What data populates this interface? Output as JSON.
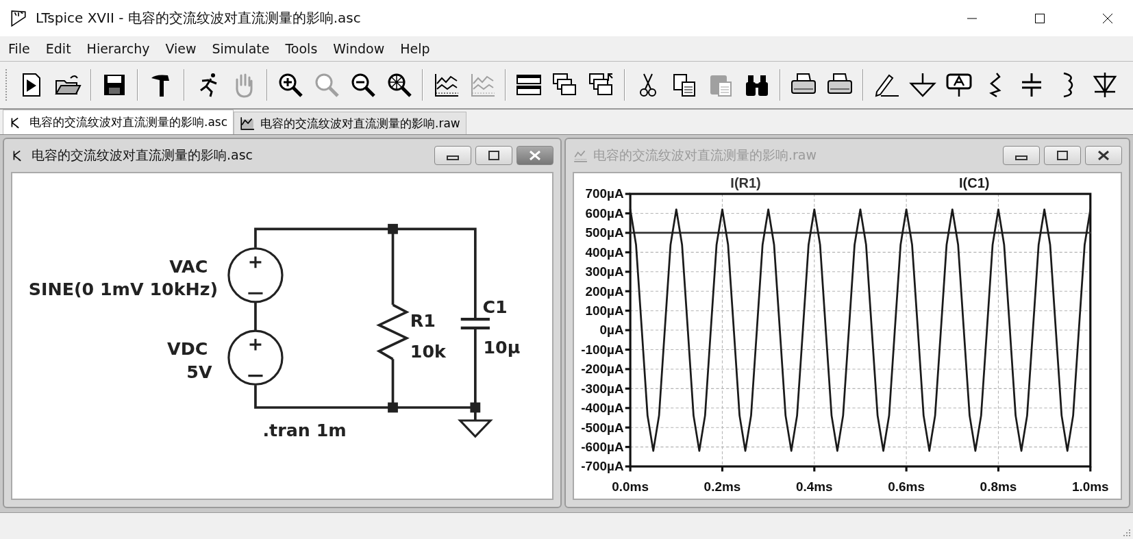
{
  "window": {
    "title": "LTspice XVII - 电容的交流纹波对直流测量的影响.asc"
  },
  "menu": [
    {
      "label": "File"
    },
    {
      "label": "Edit"
    },
    {
      "label": "Hierarchy"
    },
    {
      "label": "View"
    },
    {
      "label": "Simulate"
    },
    {
      "label": "Tools"
    },
    {
      "label": "Window"
    },
    {
      "label": "Help"
    }
  ],
  "toolbar": [
    {
      "kind": "run",
      "disabled": false
    },
    {
      "kind": "open",
      "disabled": false
    },
    {
      "kind": "separator"
    },
    {
      "kind": "save",
      "disabled": false
    },
    {
      "kind": "separator"
    },
    {
      "kind": "hammer",
      "disabled": false
    },
    {
      "kind": "separator"
    },
    {
      "kind": "halt",
      "disabled": false
    },
    {
      "kind": "hand",
      "disabled": true
    },
    {
      "kind": "separator"
    },
    {
      "kind": "zoom-in",
      "disabled": false
    },
    {
      "kind": "zoom-back",
      "disabled": true
    },
    {
      "kind": "zoom-out",
      "disabled": false
    },
    {
      "kind": "zoom-fit",
      "disabled": false
    },
    {
      "kind": "separator"
    },
    {
      "kind": "chart",
      "disabled": false
    },
    {
      "kind": "chart-3d",
      "disabled": true
    },
    {
      "kind": "separator"
    },
    {
      "kind": "tile",
      "disabled": false
    },
    {
      "kind": "cascade",
      "disabled": false
    },
    {
      "kind": "arrange",
      "disabled": false
    },
    {
      "kind": "separator"
    },
    {
      "kind": "cut",
      "disabled": false
    },
    {
      "kind": "copy",
      "disabled": false
    },
    {
      "kind": "paste",
      "disabled": true
    },
    {
      "kind": "find",
      "disabled": false
    },
    {
      "kind": "separator"
    },
    {
      "kind": "print-preview",
      "disabled": false
    },
    {
      "kind": "print",
      "disabled": false
    },
    {
      "kind": "separator"
    },
    {
      "kind": "pencil",
      "disabled": false
    },
    {
      "kind": "ground",
      "disabled": false
    },
    {
      "kind": "label",
      "disabled": false
    },
    {
      "kind": "resistor",
      "disabled": false
    },
    {
      "kind": "capacitor",
      "disabled": false
    },
    {
      "kind": "inductor",
      "disabled": false
    },
    {
      "kind": "diode",
      "disabled": false
    }
  ],
  "tabs": [
    {
      "kind": "schematic",
      "label": "电容的交流纹波对直流测量的影响.asc",
      "selected": true
    },
    {
      "kind": "waveform",
      "label": "电容的交流纹波对直流测量的影响.raw",
      "selected": false
    }
  ],
  "schematic_window": {
    "title": "电容的交流纹波对直流测量的影响.asc",
    "active": true,
    "labels": {
      "vac_name": "VAC",
      "vac_value": "SINE(0 1mV 10kHz)",
      "vdc_name": "VDC",
      "vdc_value": "5V",
      "r_name": "R1",
      "r_value": "10k",
      "c_name": "C1",
      "c_value": "10μ",
      "directive": ".tran 1m"
    }
  },
  "plot_window": {
    "title": "电容的交流纹波对直流测量的影响.raw",
    "active": false,
    "chart_data": {
      "type": "line",
      "grid": true,
      "x": [
        0,
        0.0125,
        0.025,
        0.0375,
        0.05,
        0.0625,
        0.075,
        0.0875,
        0.1,
        0.1125,
        0.125,
        0.1375,
        0.15,
        0.1625,
        0.175,
        0.1875,
        0.2,
        0.2125,
        0.225,
        0.2375,
        0.25,
        0.2625,
        0.275,
        0.2875,
        0.3,
        0.3125,
        0.325,
        0.3375,
        0.35,
        0.3625,
        0.375,
        0.3875,
        0.4,
        0.4125,
        0.425,
        0.4375,
        0.45,
        0.4625,
        0.475,
        0.4875,
        0.5,
        0.5125,
        0.525,
        0.5375,
        0.55,
        0.5625,
        0.575,
        0.5875,
        0.6,
        0.6125,
        0.625,
        0.6375,
        0.65,
        0.6625,
        0.675,
        0.6875,
        0.7,
        0.7125,
        0.725,
        0.7375,
        0.75,
        0.7625,
        0.775,
        0.7875,
        0.8,
        0.8125,
        0.825,
        0.8375,
        0.85,
        0.8625,
        0.875,
        0.8875,
        0.9,
        0.9125,
        0.925,
        0.9375,
        0.95,
        0.9625,
        0.975,
        0.9875,
        1
      ],
      "series": [
        {
          "name": "I(R1)",
          "color": "#333333",
          "values": [
            500,
            500,
            500,
            500,
            500,
            500,
            500,
            500,
            500,
            500,
            500,
            500,
            500,
            500,
            500,
            500,
            500,
            500,
            500,
            500,
            500,
            500,
            500,
            500,
            500,
            500,
            500,
            500,
            500,
            500,
            500,
            500,
            500,
            500,
            500,
            500,
            500,
            500,
            500,
            500,
            500,
            500,
            500,
            500,
            500,
            500,
            500,
            500,
            500,
            500,
            500,
            500,
            500,
            500,
            500,
            500,
            500,
            500,
            500,
            500,
            500,
            500,
            500,
            500,
            500,
            500,
            500,
            500,
            500,
            500,
            500,
            500,
            500,
            500,
            500,
            500,
            500,
            500,
            500,
            500,
            500
          ]
        },
        {
          "name": "I(C1)",
          "color": "#1a1a1a",
          "values": [
            620,
            438,
            0,
            -438,
            -620,
            -438,
            0,
            438,
            620,
            438,
            0,
            -438,
            -620,
            -438,
            0,
            438,
            620,
            438,
            0,
            -438,
            -620,
            -438,
            0,
            438,
            620,
            438,
            0,
            -438,
            -620,
            -438,
            0,
            438,
            620,
            438,
            0,
            -438,
            -620,
            -438,
            0,
            438,
            620,
            438,
            0,
            -438,
            -620,
            -438,
            0,
            438,
            620,
            438,
            0,
            -438,
            -620,
            -438,
            0,
            438,
            620,
            438,
            0,
            -438,
            -620,
            -438,
            0,
            438,
            620,
            438,
            0,
            -438,
            -620,
            -438,
            0,
            438,
            620,
            438,
            0,
            -438,
            -620,
            -438,
            0,
            438,
            620
          ]
        }
      ],
      "xlim": [
        0,
        1
      ],
      "ylim": [
        -700,
        700
      ],
      "xticks": [
        {
          "value": 0,
          "label": "0.0ms"
        },
        {
          "value": 0.2,
          "label": "0.2ms"
        },
        {
          "value": 0.4,
          "label": "0.4ms"
        },
        {
          "value": 0.6,
          "label": "0.6ms"
        },
        {
          "value": 0.8,
          "label": "0.8ms"
        },
        {
          "value": 1,
          "label": "1.0ms"
        }
      ],
      "yticks": [
        {
          "value": 700,
          "label": "700µA"
        },
        {
          "value": 600,
          "label": "600µA"
        },
        {
          "value": 500,
          "label": "500µA"
        },
        {
          "value": 400,
          "label": "400µA"
        },
        {
          "value": 300,
          "label": "300µA"
        },
        {
          "value": 200,
          "label": "200µA"
        },
        {
          "value": 100,
          "label": "100µA"
        },
        {
          "value": 0,
          "label": "0µA"
        },
        {
          "value": -100,
          "label": "-100µA"
        },
        {
          "value": -200,
          "label": "-200µA"
        },
        {
          "value": -300,
          "label": "-300µA"
        },
        {
          "value": -400,
          "label": "-400µA"
        },
        {
          "value": -500,
          "label": "-500µA"
        },
        {
          "value": -600,
          "label": "-600µA"
        },
        {
          "value": -700,
          "label": "-700µA"
        }
      ]
    }
  }
}
